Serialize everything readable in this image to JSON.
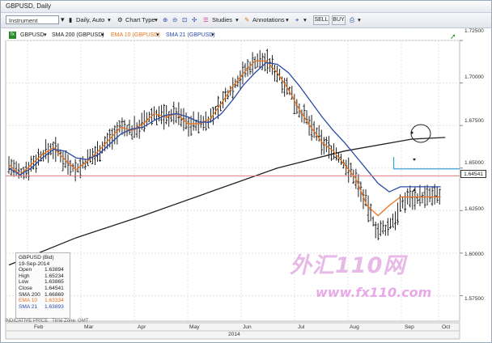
{
  "window": {
    "title": "GBPUSD, Daily"
  },
  "toolbar": {
    "instrument_placeholder": "Instrument",
    "interval": "Daily, Auto",
    "chart_type": "Chart Type",
    "studies": "Studies",
    "annotations": "Annotations",
    "sell": "SELL",
    "buy": "BUY"
  },
  "legend": {
    "symbol": "GBPUSD",
    "sma200": "SMA 200 (GBPUSD)",
    "ema10": "EMA 10 (GBPUSD)",
    "sma21": "SMA 21 (GBPUSD)"
  },
  "ohlc_panel": {
    "title": "GBPUSD (Bid)",
    "date": "19-Sep-2014",
    "rows": [
      {
        "k": "Open",
        "v": "1.63894",
        "color": "#222222"
      },
      {
        "k": "High",
        "v": "1.65234",
        "color": "#222222"
      },
      {
        "k": "Low",
        "v": "1.63865",
        "color": "#222222"
      },
      {
        "k": "Close",
        "v": "1.64541",
        "color": "#222222"
      },
      {
        "k": "SMA 200",
        "v": "1.66869",
        "color": "#222222"
      },
      {
        "k": "EMA 10",
        "v": "1.63334",
        "color": "#e8731f"
      },
      {
        "k": "SMA 21",
        "v": "1.63893",
        "color": "#2a4aa8"
      }
    ]
  },
  "footer": {
    "left": "INDICATIVE PRICE",
    "right": "Time Zone: GMT"
  },
  "price_tag": "1.64541",
  "watermark": {
    "line1": "外汇110网",
    "line2": "www.fx110.com"
  },
  "colors": {
    "sma200": "#222222",
    "ema10": "#e8731f",
    "sma21": "#2a4aa8",
    "bars": "#222222",
    "hline_red": "#e07a7a",
    "hline_blue": "#3fa3d6"
  },
  "chart_data": {
    "type": "line",
    "y_ticks": [
      "1.72500",
      "1.70000",
      "1.67500",
      "1.65000",
      "1.62500",
      "1.60000",
      "1.57500"
    ],
    "ylim": [
      1.56,
      1.725
    ],
    "x_ticks": [
      "Feb",
      "Mar",
      "Apr",
      "May",
      "Jun",
      "Jul",
      "Aug",
      "Sep",
      "Oct"
    ],
    "x_caption": "2014",
    "series": [
      {
        "name": "SMA 200",
        "x": [
          0,
          30,
          60,
          90,
          120,
          150,
          180,
          195
        ],
        "values": [
          1.593,
          1.609,
          1.622,
          1.636,
          1.65,
          1.66,
          1.667,
          1.668
        ]
      },
      {
        "name": "EMA 10",
        "x": [
          0,
          5,
          10,
          15,
          20,
          25,
          30,
          35,
          40,
          45,
          50,
          55,
          60,
          65,
          70,
          75,
          80,
          85,
          90,
          95,
          100,
          105,
          110,
          115,
          120,
          125,
          130,
          135,
          140,
          145,
          150,
          155,
          160,
          165,
          170,
          175,
          180,
          185,
          190,
          193
        ],
        "values": [
          1.652,
          1.646,
          1.652,
          1.658,
          1.662,
          1.655,
          1.649,
          1.654,
          1.66,
          1.667,
          1.674,
          1.672,
          1.676,
          1.682,
          1.68,
          1.682,
          1.676,
          1.676,
          1.679,
          1.688,
          1.698,
          1.706,
          1.713,
          1.713,
          1.706,
          1.696,
          1.684,
          1.674,
          1.665,
          1.66,
          1.652,
          1.644,
          1.628,
          1.622,
          1.628,
          1.633,
          1.633,
          1.633,
          1.633,
          1.633
        ]
      },
      {
        "name": "SMA 21",
        "x": [
          0,
          5,
          10,
          15,
          20,
          25,
          30,
          35,
          40,
          45,
          50,
          55,
          60,
          65,
          70,
          75,
          80,
          85,
          90,
          95,
          100,
          105,
          110,
          115,
          120,
          125,
          130,
          135,
          140,
          145,
          150,
          155,
          160,
          165,
          170,
          175,
          180,
          185,
          190,
          193
        ],
        "values": [
          1.65,
          1.646,
          1.65,
          1.656,
          1.661,
          1.66,
          1.656,
          1.655,
          1.658,
          1.664,
          1.67,
          1.673,
          1.674,
          1.678,
          1.681,
          1.682,
          1.68,
          1.677,
          1.677,
          1.682,
          1.69,
          1.699,
          1.706,
          1.712,
          1.711,
          1.706,
          1.698,
          1.689,
          1.68,
          1.672,
          1.665,
          1.657,
          1.649,
          1.641,
          1.636,
          1.639,
          1.639,
          1.639,
          1.639,
          1.639
        ]
      }
    ],
    "annotation": "circle near 1.6685"
  }
}
